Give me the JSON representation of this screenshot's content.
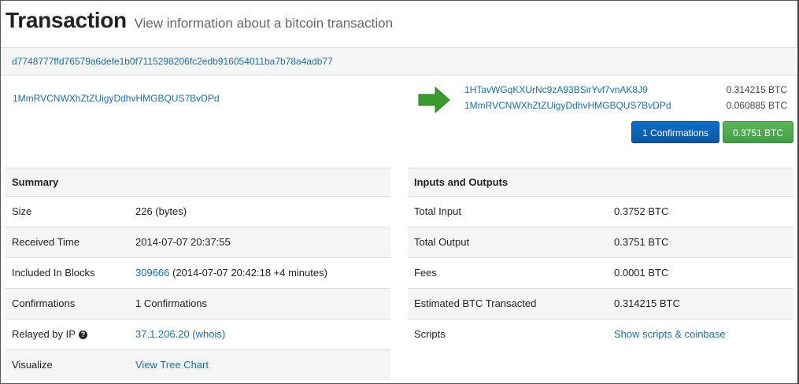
{
  "header": {
    "title": "Transaction",
    "subtitle": "View information about a bitcoin transaction"
  },
  "tx_hash": "d7748777ffd76579a6defe1b0f7115298206fc2edb916054011ba7b78a4adb77",
  "inputs": [
    {
      "address": "1MmRVCNWXhZtZUigyDdhvHMGBQUS7BvDPd"
    }
  ],
  "outputs": [
    {
      "address": "1HTavWGqKXUrNc9zA93BSirYvf7vnAK8J9",
      "amount": "0.314215 BTC"
    },
    {
      "address": "1MmRVCNWXhZtZUigyDdhvHMGBQUS7BvDPd",
      "amount": "0.060885 BTC"
    }
  ],
  "buttons": {
    "confirmations": "1 Confirmations",
    "total": "0.3751 BTC"
  },
  "colors": {
    "link": "#1a6fb0",
    "blue_button": "#0d6ec8",
    "green_button": "#5cb85c",
    "arrow": "#3a9a2e"
  },
  "summary": {
    "heading": "Summary",
    "size_label": "Size",
    "size_value": "226 (bytes)",
    "received_label": "Received Time",
    "received_value": "2014-07-07 20:37:55",
    "blocks_label": "Included In Blocks",
    "block_link": "309666",
    "block_detail": " (2014-07-07 20:42:18 +4 minutes)",
    "confirmations_label": "Confirmations",
    "confirmations_value": "1 Confirmations",
    "relayed_label": "Relayed by IP",
    "relayed_icon": "help-icon",
    "relayed_value": "37.1.206.20 (whois)",
    "visualize_label": "Visualize",
    "visualize_value": "View Tree Chart"
  },
  "io": {
    "heading": "Inputs and Outputs",
    "total_input_label": "Total Input",
    "total_input_value": "0.3752 BTC",
    "total_output_label": "Total Output",
    "total_output_value": "0.3751 BTC",
    "fees_label": "Fees",
    "fees_value": "0.0001 BTC",
    "estimated_label": "Estimated BTC Transacted",
    "estimated_value": "0.314215 BTC",
    "scripts_label": "Scripts",
    "scripts_value": "Show scripts & coinbase"
  }
}
